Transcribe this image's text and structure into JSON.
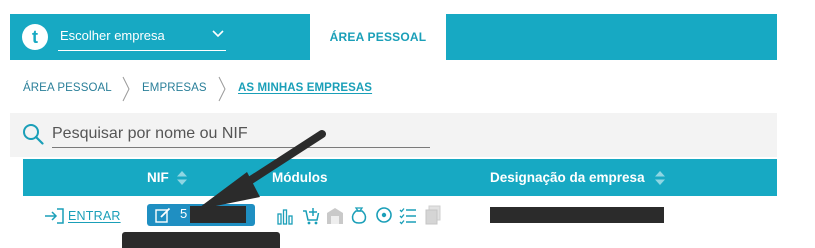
{
  "header": {
    "logo_letter": "t",
    "company_select_label": "Escolher empresa",
    "active_tab_label": "ÁREA PESSOAL"
  },
  "breadcrumb": {
    "items": [
      "ÁREA PESSOAL",
      "EMPRESAS",
      "AS MINHAS EMPRESAS"
    ]
  },
  "search": {
    "placeholder": "Pesquisar por nome ou NIF"
  },
  "table": {
    "columns": [
      "NIF",
      "Módulos",
      "Designação da empresa"
    ],
    "rows": [
      {
        "action_label": "ENTRAR",
        "nif_visible": "5",
        "modules": [
          "bar-chart-icon",
          "cart-add-icon",
          "warehouse-icon",
          "money-bag-icon",
          "disc-icon",
          "checklist-icon",
          "documents-icon"
        ]
      }
    ]
  },
  "colors": {
    "brand": "#17a9c3",
    "nif_badge": "#1f8fc2",
    "link": "#1a9fb8",
    "annotation_arrow": "#2b2b2b"
  }
}
